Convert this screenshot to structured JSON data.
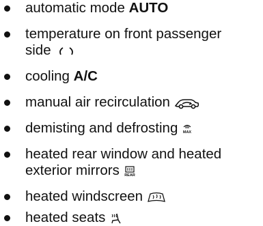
{
  "items": [
    {
      "text": "automatic mode ",
      "bold": "AUTO"
    },
    {
      "line1": "temperature on front passenger",
      "line2": "side"
    },
    {
      "text": "cooling ",
      "bold": "A/C"
    },
    {
      "text": "manual air recirculation",
      "icon": "air-recirculation-icon"
    },
    {
      "text": "demisting and defrosting",
      "icon": "max-defrost-icon",
      "icon_label": "MAX"
    },
    {
      "line1": "heated rear window and heated",
      "line2": "exterior mirrors",
      "icon": "rear-defrost-icon",
      "icon_label": "REAR"
    },
    {
      "text": "heated windscreen",
      "icon": "heated-windscreen-icon"
    },
    {
      "text": "heated seats",
      "icon": "heated-seat-icon"
    }
  ]
}
